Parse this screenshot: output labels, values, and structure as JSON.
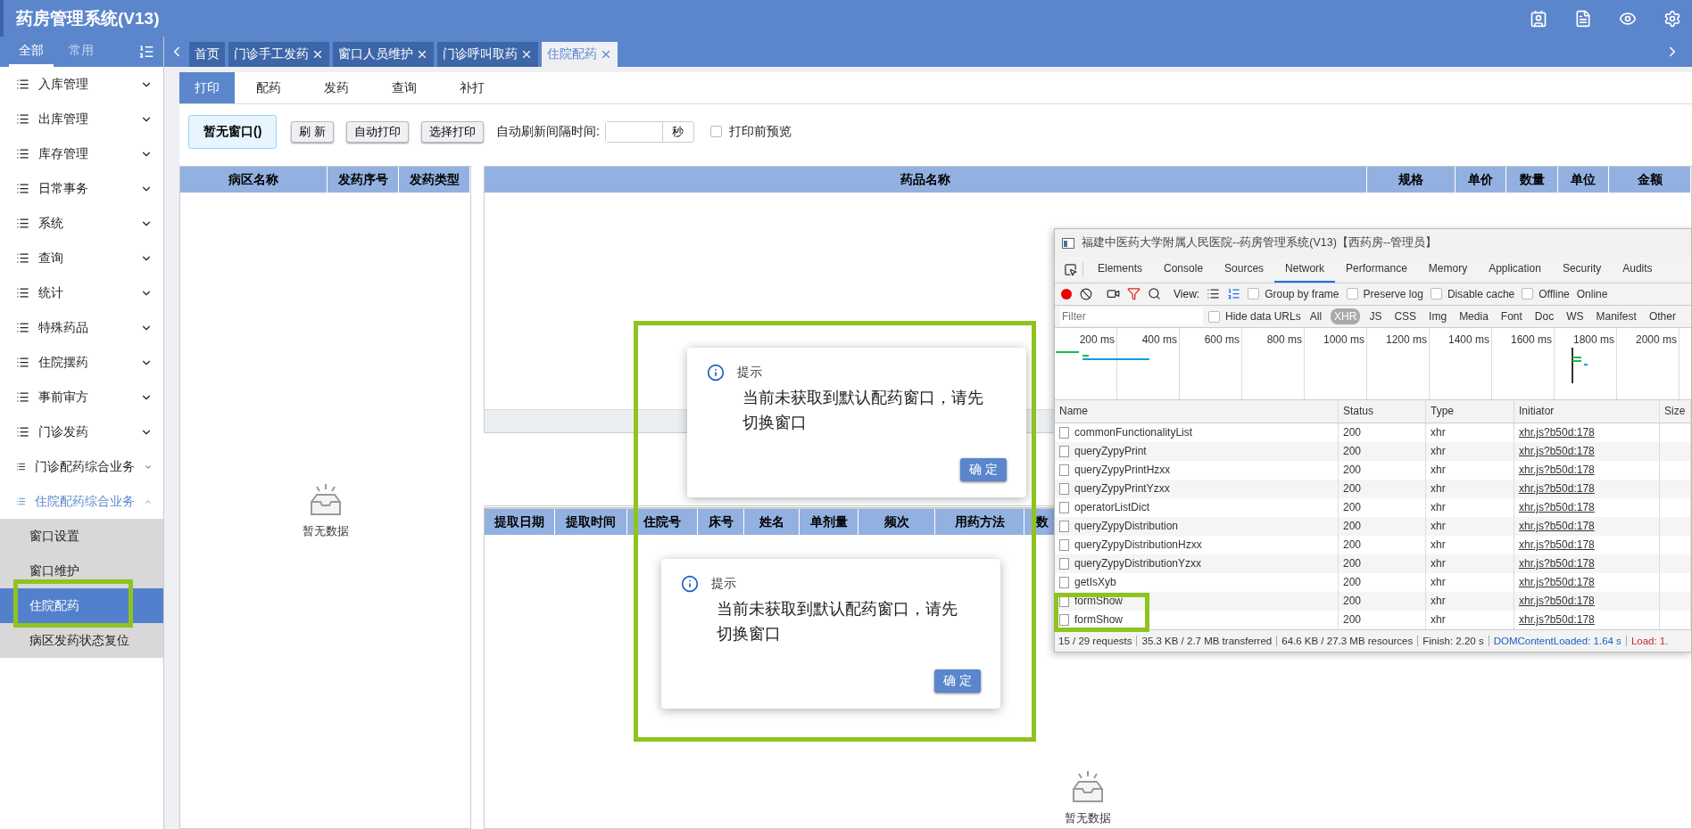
{
  "app": {
    "title": "药房管理系统(V13)"
  },
  "sidebar": {
    "tabs": [
      {
        "label": "全部",
        "selected": true
      },
      {
        "label": "常用",
        "selected": false
      }
    ],
    "items": [
      {
        "label": "入库管理",
        "expanded": false
      },
      {
        "label": "出库管理",
        "expanded": false
      },
      {
        "label": "库存管理",
        "expanded": false
      },
      {
        "label": "日常事务",
        "expanded": false
      },
      {
        "label": "系统",
        "expanded": false
      },
      {
        "label": "查询",
        "expanded": false
      },
      {
        "label": "统计",
        "expanded": false
      },
      {
        "label": "特殊药品",
        "expanded": false
      },
      {
        "label": "住院摆药",
        "expanded": false
      },
      {
        "label": "事前审方",
        "expanded": false
      },
      {
        "label": "门诊发药",
        "expanded": false
      },
      {
        "label": "门诊配药综合业务",
        "expanded": false
      },
      {
        "label": "住院配药综合业务",
        "expanded": true,
        "children": [
          {
            "label": "窗口设置",
            "selected": false
          },
          {
            "label": "窗口维护",
            "selected": false
          },
          {
            "label": "住院配药",
            "selected": true
          },
          {
            "label": "病区发药状态复位",
            "selected": false
          }
        ]
      }
    ]
  },
  "page_tabs": [
    {
      "label": "首页",
      "closable": false,
      "selected": false
    },
    {
      "label": "门诊手工发药",
      "closable": true,
      "selected": false
    },
    {
      "label": "窗口人员维护",
      "closable": true,
      "selected": false
    },
    {
      "label": "门诊呼叫取药",
      "closable": true,
      "selected": false
    },
    {
      "label": "住院配药",
      "closable": true,
      "selected": true
    }
  ],
  "sub_tabs": [
    {
      "label": "打印",
      "selected": true
    },
    {
      "label": "配药",
      "selected": false
    },
    {
      "label": "发药",
      "selected": false
    },
    {
      "label": "查询",
      "selected": false
    },
    {
      "label": "补打",
      "selected": false
    }
  ],
  "toolbar": {
    "window_button": "暂无窗口()",
    "buttons": [
      "刷 新",
      "自动打印",
      "选择打印"
    ],
    "interval_label": "自动刷新间隔时间:",
    "interval_unit": "秒",
    "preview": {
      "label": "打印前预览",
      "checked": false
    }
  },
  "ward_table": {
    "columns": [
      "病区名称",
      "发药序号",
      "发药类型"
    ],
    "empty_text": "暂无数据"
  },
  "drug_table": {
    "columns": [
      "药品名称",
      "规格",
      "单价",
      "数量",
      "单位",
      "金额"
    ]
  },
  "detail_table": {
    "columns": [
      "提取日期",
      "提取时间",
      "住院号",
      "床号",
      "姓名",
      "单剂量",
      "频次",
      "用药方法",
      "数"
    ],
    "empty_text": "暂无数据"
  },
  "dialogs": [
    {
      "title": "提示",
      "message": "当前未获取到默认配药窗口，请先切换窗口",
      "button": "确 定"
    },
    {
      "title": "提示",
      "message": "当前未获取到默认配药窗口，请先切换窗口",
      "button": "确 定"
    }
  ],
  "devtools": {
    "title": "福建中医药大学附属人民医院--药房管理系统(V13)【西药房--管理员】",
    "tabs": [
      {
        "label": "Elements",
        "selected": false
      },
      {
        "label": "Console",
        "selected": false
      },
      {
        "label": "Sources",
        "selected": false
      },
      {
        "label": "Network",
        "selected": true
      },
      {
        "label": "Performance",
        "selected": false
      },
      {
        "label": "Memory",
        "selected": false
      },
      {
        "label": "Application",
        "selected": false
      },
      {
        "label": "Security",
        "selected": false
      },
      {
        "label": "Audits",
        "selected": false
      }
    ],
    "view_label": "View:",
    "options": [
      {
        "label": "Group by frame",
        "checked": false
      },
      {
        "label": "Preserve log",
        "checked": false
      },
      {
        "label": "Disable cache",
        "checked": false
      },
      {
        "label": "Offline",
        "checked": false
      }
    ],
    "throttle": "Online",
    "filter_placeholder": "Filter",
    "hide_data_urls": {
      "label": "Hide data URLs",
      "checked": false
    },
    "types": [
      {
        "label": "All",
        "selected": false
      },
      {
        "label": "XHR",
        "selected": true
      },
      {
        "label": "JS",
        "selected": false
      },
      {
        "label": "CSS",
        "selected": false
      },
      {
        "label": "Img",
        "selected": false
      },
      {
        "label": "Media",
        "selected": false
      },
      {
        "label": "Font",
        "selected": false
      },
      {
        "label": "Doc",
        "selected": false
      },
      {
        "label": "WS",
        "selected": false
      },
      {
        "label": "Manifest",
        "selected": false
      },
      {
        "label": "Other",
        "selected": false
      }
    ],
    "timeline_ticks": [
      "200 ms",
      "400 ms",
      "600 ms",
      "800 ms",
      "1000 ms",
      "1200 ms",
      "1400 ms",
      "1600 ms",
      "1800 ms",
      "2000 ms"
    ],
    "columns": [
      "Name",
      "Status",
      "Type",
      "Initiator",
      "Size"
    ],
    "rows": [
      {
        "name": "commonFunctionalityList",
        "status": "200",
        "type": "xhr",
        "initiator": "xhr.js?b50d:178"
      },
      {
        "name": "queryZypyPrint",
        "status": "200",
        "type": "xhr",
        "initiator": "xhr.js?b50d:178"
      },
      {
        "name": "queryZypyPrintHzxx",
        "status": "200",
        "type": "xhr",
        "initiator": "xhr.js?b50d:178"
      },
      {
        "name": "queryZypyPrintYzxx",
        "status": "200",
        "type": "xhr",
        "initiator": "xhr.js?b50d:178"
      },
      {
        "name": "operatorListDict",
        "status": "200",
        "type": "xhr",
        "initiator": "xhr.js?b50d:178"
      },
      {
        "name": "queryZypyDistribution",
        "status": "200",
        "type": "xhr",
        "initiator": "xhr.js?b50d:178"
      },
      {
        "name": "queryZypyDistributionHzxx",
        "status": "200",
        "type": "xhr",
        "initiator": "xhr.js?b50d:178"
      },
      {
        "name": "queryZypyDistributionYzxx",
        "status": "200",
        "type": "xhr",
        "initiator": "xhr.js?b50d:178"
      },
      {
        "name": "getIsXyb",
        "status": "200",
        "type": "xhr",
        "initiator": "xhr.js?b50d:178"
      },
      {
        "name": "formShow",
        "status": "200",
        "type": "xhr",
        "initiator": "xhr.js?b50d:178"
      },
      {
        "name": "formShow",
        "status": "200",
        "type": "xhr",
        "initiator": "xhr.js?b50d:178"
      }
    ],
    "summary": [
      {
        "text": "15 / 29 requests",
        "kind": "plain"
      },
      {
        "text": "35.3 KB / 2.7 MB transferred",
        "kind": "plain"
      },
      {
        "text": "64.6 KB / 27.3 MB resources",
        "kind": "plain"
      },
      {
        "text": "Finish: 2.20 s",
        "kind": "plain"
      },
      {
        "text": "DOMContentLoaded: 1.64 s",
        "kind": "dom"
      },
      {
        "text": "Load: 1.",
        "kind": "load"
      }
    ]
  }
}
